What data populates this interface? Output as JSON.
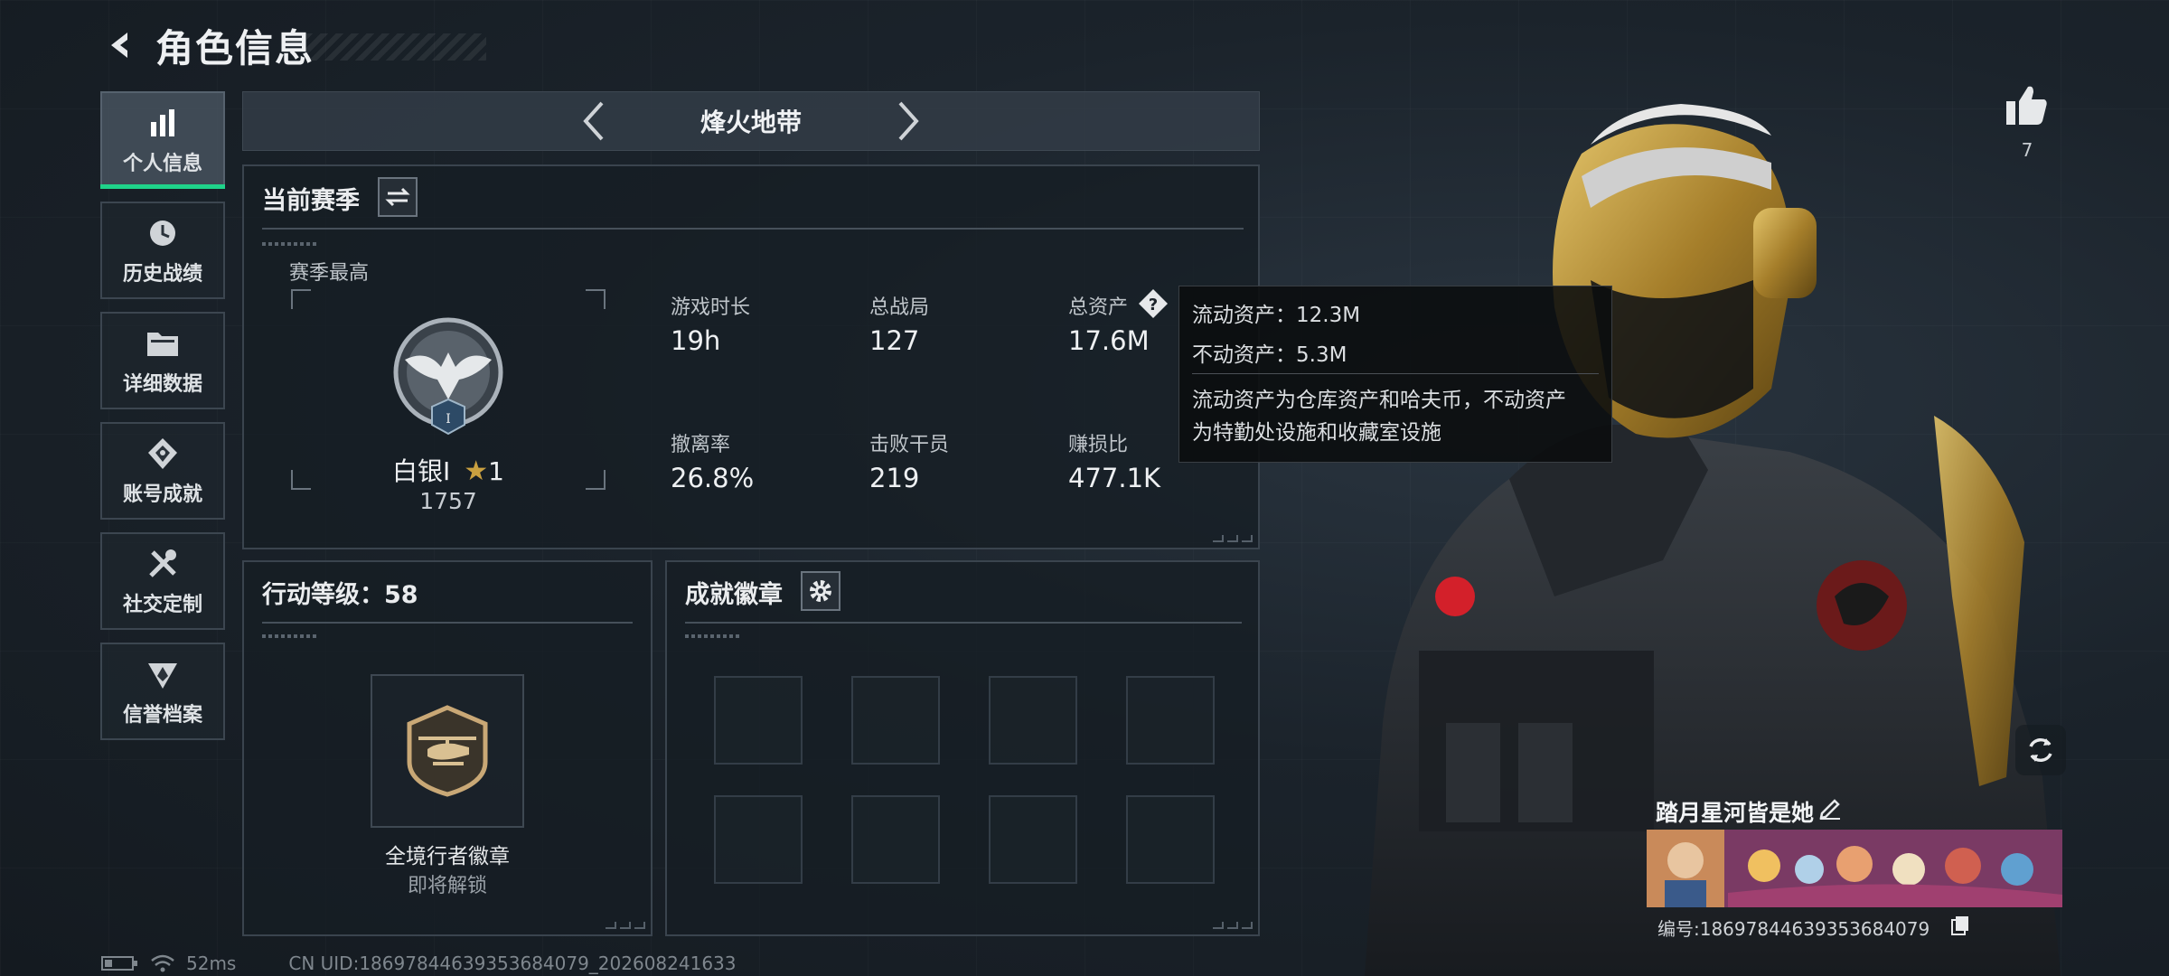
{
  "header": {
    "title": "角色信息"
  },
  "sidebar": {
    "items": [
      {
        "label": "个人信息",
        "icon": "bar-chart-icon",
        "active": true
      },
      {
        "label": "历史战绩",
        "icon": "history-clock-icon",
        "active": false
      },
      {
        "label": "详细数据",
        "icon": "folder-icon",
        "active": false
      },
      {
        "label": "账号成就",
        "icon": "achievement-icon",
        "active": false
      },
      {
        "label": "社交定制",
        "icon": "tools-icon",
        "active": false
      },
      {
        "label": "信誉档案",
        "icon": "shield-icon",
        "active": false
      }
    ]
  },
  "mode": {
    "title": "烽火地带"
  },
  "season": {
    "title": "当前赛季",
    "best_label": "赛季最高",
    "rank_name": "白银I",
    "rank_stars": "1",
    "rank_score": "1757",
    "rank_emblem_numeral": "I",
    "stats": [
      {
        "label": "游戏时长",
        "value": "19h"
      },
      {
        "label": "总战局",
        "value": "127"
      },
      {
        "label": "总资产",
        "value": "17.6M"
      },
      {
        "label": "撤离率",
        "value": "26.8%"
      },
      {
        "label": "击败干员",
        "value": "219"
      },
      {
        "label": "赚损比",
        "value": "477.1K"
      }
    ]
  },
  "tooltip": {
    "liquid": "流动资产：12.3M",
    "fixed": "不动资产：5.3M",
    "desc_line1": "流动资产为仓库资产和哈夫币，不动资产",
    "desc_line2": "为特勤处设施和收藏室设施"
  },
  "action_level": {
    "title": "行动等级：58",
    "badge_name": "全境行者徽章",
    "badge_status": "即将解锁"
  },
  "achievements": {
    "title": "成就徽章",
    "slots": 8
  },
  "profile": {
    "likes": "7",
    "name": "踏月星河皆是她",
    "id": "编号:18697844639353684079"
  },
  "status": {
    "ping": "52ms",
    "uid": "CN UID:18697844639353684079_202608241633"
  },
  "colors": {
    "accent": "#1fd38a",
    "gold": "#c9a040"
  }
}
